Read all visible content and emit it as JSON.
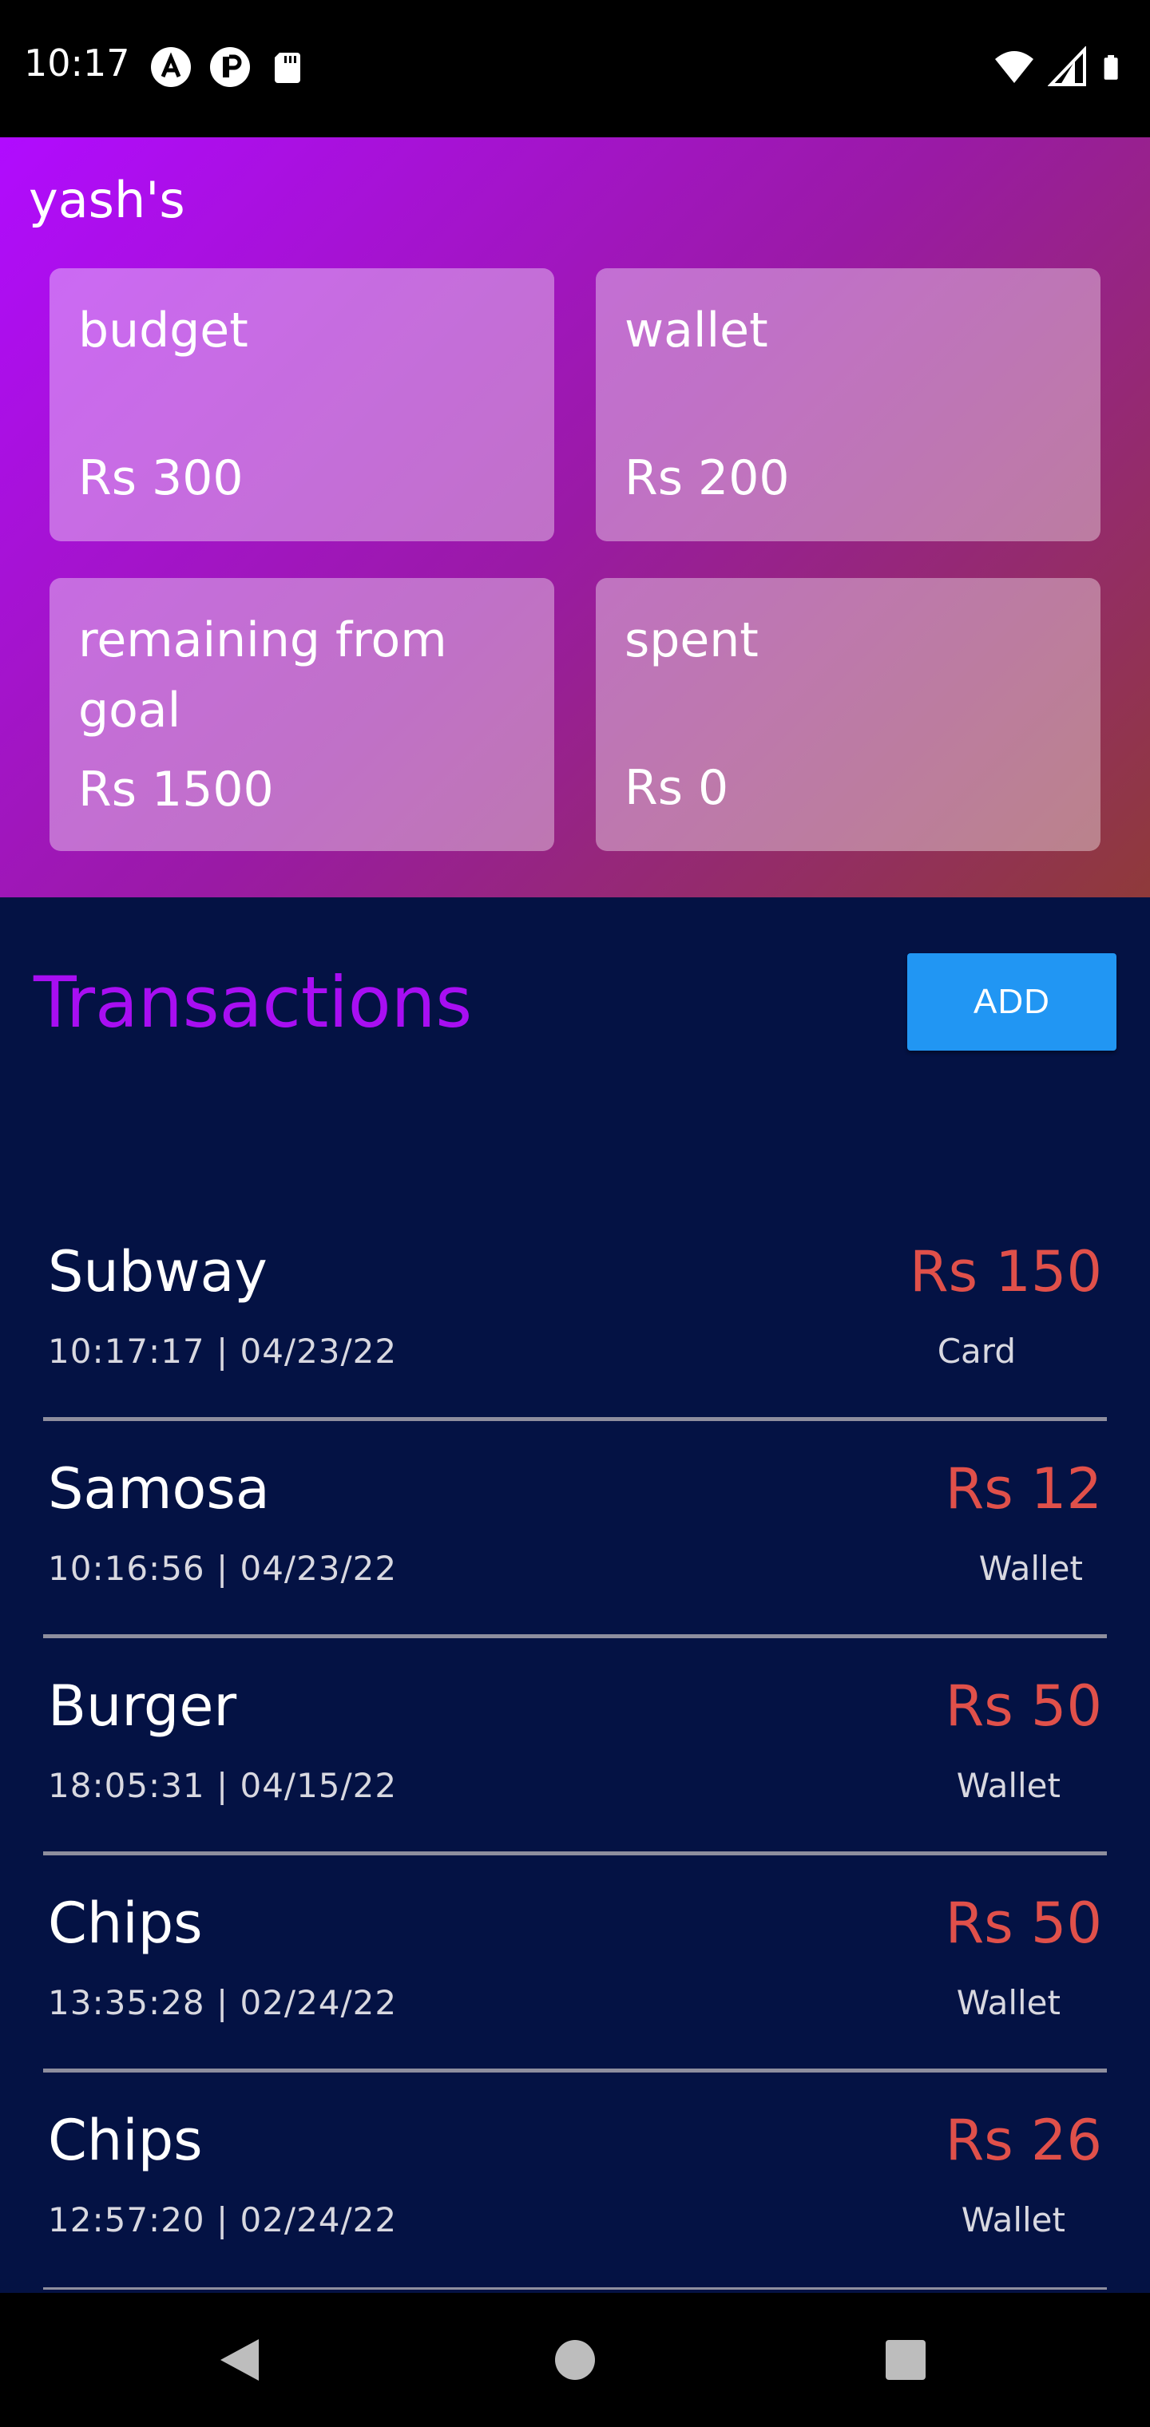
{
  "status_bar": {
    "time": "10:17",
    "left_icons": [
      "a-icon",
      "p-icon",
      "sd-card-icon"
    ],
    "right_icons": [
      "wifi-icon",
      "signal-icon",
      "battery-icon"
    ]
  },
  "header": {
    "owner": "yash's",
    "cards": [
      {
        "label": "budget",
        "value": "Rs 300"
      },
      {
        "label": "wallet",
        "value": "Rs 200"
      },
      {
        "label": "remaining from goal",
        "value": "Rs 1500"
      },
      {
        "label": "spent",
        "value": "Rs 0"
      }
    ]
  },
  "transactions": {
    "title": "Transactions",
    "add_label": "ADD",
    "items": [
      {
        "name": "Subway",
        "datetime": "10:17:17 | 04/23/22",
        "amount": "Rs 150",
        "method": "Card"
      },
      {
        "name": "Samosa",
        "datetime": "10:16:56 | 04/23/22",
        "amount": "Rs 12",
        "method": "Wallet"
      },
      {
        "name": "Burger",
        "datetime": "18:05:31 | 04/15/22",
        "amount": "Rs 50",
        "method": "Wallet"
      },
      {
        "name": "Chips",
        "datetime": "13:35:28 | 02/24/22",
        "amount": "Rs 50",
        "method": "Wallet"
      },
      {
        "name": "Chips",
        "datetime": "12:57:20 | 02/24/22",
        "amount": "Rs 26",
        "method": "Wallet"
      }
    ]
  },
  "colors": {
    "accent_title": "#a80ef2",
    "add_button": "#2196f3",
    "amount": "#e0504a",
    "background": "#041244"
  },
  "nav": [
    "back-icon",
    "home-icon",
    "recents-icon"
  ]
}
